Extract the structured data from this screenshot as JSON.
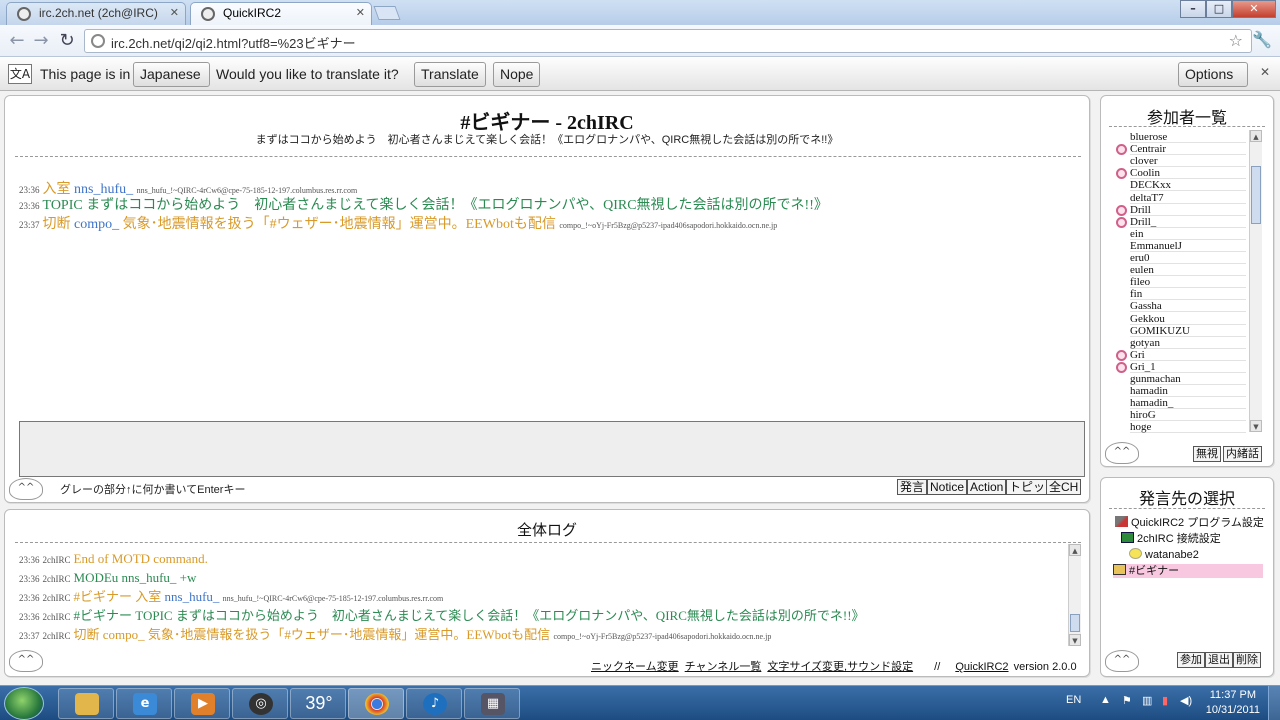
{
  "browser": {
    "tabs": [
      {
        "title": "irc.2ch.net (2ch@IRC)"
      },
      {
        "title": "QuickIRC2"
      }
    ],
    "url": "irc.2ch.net/qi2/qi2.html?utf8=%23ビギナー",
    "translate_bar": {
      "prefix": "This page is in",
      "language": "Japanese",
      "question": "Would you like to translate it?",
      "translate_label": "Translate",
      "nope_label": "Nope",
      "options_label": "Options"
    }
  },
  "channel": {
    "title": "#ビギナー - 2chIRC",
    "topic": "まずはココから始めよう　初心者さんまじえて楽しく会話！《エログロナンパや、QIRC無視した会話は別の所でネ!!》",
    "messages": [
      {
        "time": "23:36",
        "verb": "入室",
        "nick": "nns_hufu_",
        "text": "",
        "host": "nns_hufu_!~QIRC-4rCw6@cpe-75-185-12-197.columbus.res.rr.com"
      },
      {
        "time": "23:36",
        "verb": "TOPIC",
        "nick": "",
        "text": "まずはココから始めよう　初心者さんまじえて楽しく会話！《エログロナンパや、QIRC無視した会話は別の所でネ!!》",
        "host": ""
      },
      {
        "time": "23:37",
        "verb": "切断",
        "nick": "compo_",
        "text": "気象･地震情報を扱う「#ウェザー･地震情報」運営中。EEWbotも配信",
        "host": "compo_!~oYj-Fr5Bzg@p5237-ipad406sapodori.hokkaido.ocn.ne.jp"
      }
    ],
    "input_hint": "グレーの部分↑に何か書いてEnterキー",
    "buttons": {
      "say": "発言",
      "notice": "Notice",
      "action": "Action",
      "topic": "トピック",
      "all_ch": "全CH"
    }
  },
  "log": {
    "title": "全体ログ",
    "lines": [
      {
        "time": "23:36",
        "src": "2chIRC",
        "text": "End of MOTD command.",
        "extra": "",
        "host": ""
      },
      {
        "time": "23:36",
        "src": "2chIRC",
        "text": "MODEu nns_hufu_ +w",
        "extra": "",
        "host": ""
      },
      {
        "time": "23:36",
        "src": "2chIRC",
        "text": "#ビギナー 入室",
        "extra": "nns_hufu_",
        "host": "nns_hufu_!~QIRC-4rCw6@cpe-75-185-12-197.columbus.res.rr.com"
      },
      {
        "time": "23:36",
        "src": "2chIRC",
        "text": "#ビギナー TOPIC まずはココから始めよう　初心者さんまじえて楽しく会話！《エログロナンパや、QIRC無視した会話は別の所でネ!!》",
        "extra": "",
        "host": ""
      },
      {
        "time": "23:37",
        "src": "2chIRC",
        "text": "切断",
        "extra": "compo_ 気象･地震情報を扱う「#ウェザー･地震情報」運営中。EEWbotも配信",
        "host": "compo_!~oYj-Fr5Bzg@p5237-ipad406sapodori.hokkaido.ocn.ne.jp"
      }
    ],
    "footer": {
      "links": [
        "ニックネーム変更",
        "チャンネル一覧",
        "文字サイズ変更,サウンド設定"
      ],
      "separator": "//",
      "app": "QuickIRC2",
      "version": "version 2.0.0"
    }
  },
  "members": {
    "title": "参加者一覧",
    "users": [
      {
        "name": "bluerose",
        "op": false
      },
      {
        "name": "Centrair",
        "op": true
      },
      {
        "name": "clover",
        "op": false
      },
      {
        "name": "Coolin",
        "op": true
      },
      {
        "name": "DECKxx",
        "op": false
      },
      {
        "name": "deltaT7",
        "op": false
      },
      {
        "name": "Drill",
        "op": true
      },
      {
        "name": "Drill_",
        "op": true
      },
      {
        "name": "ein",
        "op": false
      },
      {
        "name": "EmmanuelJ",
        "op": false
      },
      {
        "name": "eru0",
        "op": false
      },
      {
        "name": "eulen",
        "op": false
      },
      {
        "name": "fileo",
        "op": false
      },
      {
        "name": "fin",
        "op": false
      },
      {
        "name": "Gassha",
        "op": false
      },
      {
        "name": "Gekkou",
        "op": false
      },
      {
        "name": "GOMIKUZU",
        "op": false
      },
      {
        "name": "gotyan",
        "op": false
      },
      {
        "name": "Gri",
        "op": true
      },
      {
        "name": "Gri_1",
        "op": true
      },
      {
        "name": "gunmachan",
        "op": false
      },
      {
        "name": "hamadin",
        "op": false
      },
      {
        "name": "hamadin_",
        "op": false
      },
      {
        "name": "hiroG",
        "op": false
      },
      {
        "name": "hoge",
        "op": false
      }
    ],
    "buttons": {
      "ignore": "無視",
      "whisper": "内緒話"
    }
  },
  "targets": {
    "title": "発言先の選択",
    "items": [
      {
        "label": "QuickIRC2 プログラム設定",
        "icon": "wrench-icon",
        "level": 0
      },
      {
        "label": "2chIRC 接続設定",
        "icon": "monitor-icon",
        "level": 1
      },
      {
        "label": "watanabe2",
        "icon": "user-icon",
        "level": 2
      },
      {
        "label": "#ビギナー",
        "icon": "channel-icon",
        "level": 0,
        "selected": true
      }
    ],
    "buttons": {
      "join": "参加",
      "part": "退出",
      "delete": "削除"
    }
  },
  "taskbar": {
    "weather": "39°",
    "lang": "EN",
    "time": "11:37 PM",
    "date": "10/31/2011"
  },
  "colors": {
    "join": "#d89a28",
    "topic": "#2b8a52",
    "nick": "#3f74c8",
    "selected_target": "#f7c8e0"
  }
}
